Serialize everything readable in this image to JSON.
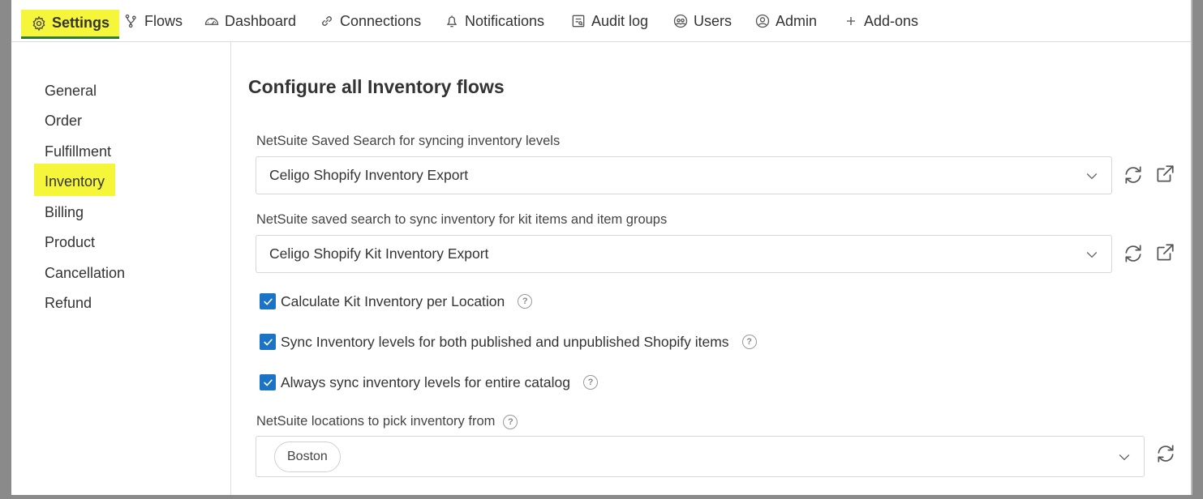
{
  "nav": {
    "items": [
      {
        "label": "Settings",
        "icon": "gear-icon",
        "active": true
      },
      {
        "label": "Flows",
        "icon": "flows-icon"
      },
      {
        "label": "Dashboard",
        "icon": "dashboard-icon"
      },
      {
        "label": "Connections",
        "icon": "link-icon"
      },
      {
        "label": "Notifications",
        "icon": "bell-icon"
      },
      {
        "label": "Audit log",
        "icon": "audit-log-icon"
      },
      {
        "label": "Users",
        "icon": "users-icon"
      },
      {
        "label": "Admin",
        "icon": "user-circle-icon"
      },
      {
        "label": "Add-ons",
        "icon": "plus-icon"
      }
    ]
  },
  "sidebar": {
    "items": [
      {
        "label": "General"
      },
      {
        "label": "Order"
      },
      {
        "label": "Fulfillment"
      },
      {
        "label": "Inventory",
        "active": true
      },
      {
        "label": "Billing"
      },
      {
        "label": "Product"
      },
      {
        "label": "Cancellation"
      },
      {
        "label": "Refund"
      }
    ]
  },
  "main": {
    "title": "Configure all Inventory flows",
    "fields": {
      "saved_search": {
        "label": "NetSuite Saved Search for syncing inventory levels",
        "value": "Celigo Shopify Inventory Export"
      },
      "kit_search": {
        "label": "NetSuite saved search to sync inventory for kit items and item groups",
        "value": "Celigo Shopify Kit Inventory Export"
      },
      "locations": {
        "label": "NetSuite locations to pick inventory from",
        "chips": [
          "Boston"
        ]
      }
    },
    "checkboxes": [
      {
        "label": "Calculate Kit Inventory per Location",
        "checked": true
      },
      {
        "label": "Sync Inventory levels for both published and unpublished Shopify items",
        "checked": true
      },
      {
        "label": "Always sync inventory levels for entire catalog",
        "checked": true
      }
    ],
    "help_glyph": "?"
  },
  "colors": {
    "highlight": "#f5f53a",
    "active_underline": "#2f7b3e",
    "checkbox": "#1b73c5"
  }
}
